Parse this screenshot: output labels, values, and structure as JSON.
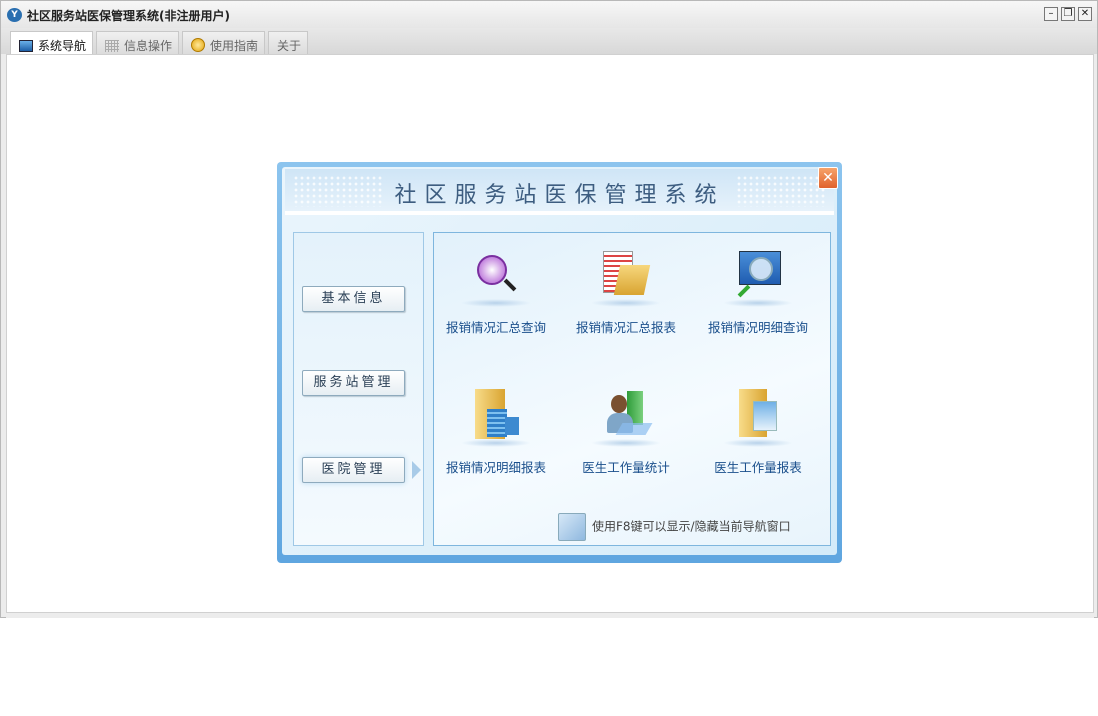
{
  "window": {
    "title": "社区服务站医保管理系统(非注册用户)",
    "minimize": "–",
    "restore": "❐",
    "close": "✕"
  },
  "tabs": [
    {
      "label": "系统导航"
    },
    {
      "label": "信息操作"
    },
    {
      "label": "使用指南"
    },
    {
      "label": "关于"
    }
  ],
  "dialog": {
    "title": "社区服务站医保管理系统",
    "close": "✕",
    "nav": [
      {
        "label": "基本信息"
      },
      {
        "label": "服务站管理"
      },
      {
        "label": "医院管理"
      }
    ],
    "items": [
      {
        "label": "报销情况汇总查询",
        "icon": "search-people-icon"
      },
      {
        "label": "报销情况汇总报表",
        "icon": "report-folder-icon"
      },
      {
        "label": "报销情况明细查询",
        "icon": "magnifier-screen-icon"
      },
      {
        "label": "报销情况明细报表",
        "icon": "folder-building-icon"
      },
      {
        "label": "医生工作量统计",
        "icon": "doctor-icon"
      },
      {
        "label": "医生工作量报表",
        "icon": "folder-window-icon"
      }
    ],
    "hint": "使用F8键可以显示/隐藏当前导航窗口"
  }
}
